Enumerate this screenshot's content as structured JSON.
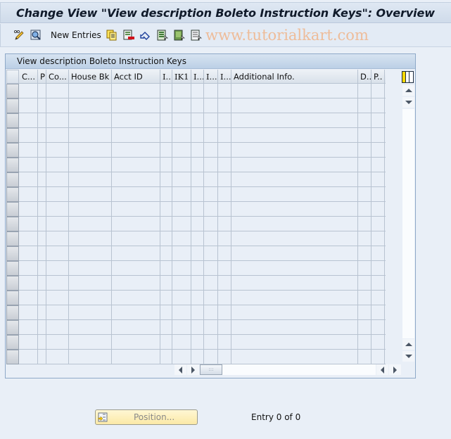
{
  "window": {
    "title": "Change View \"View description Boleto Instruction Keys\": Overview"
  },
  "toolbar": {
    "items": [
      {
        "name": "display-change-icon",
        "label": ""
      },
      {
        "name": "details-icon",
        "label": ""
      },
      {
        "name": "new-entries-button",
        "label": "New Entries"
      },
      {
        "name": "copy-as-icon",
        "label": ""
      },
      {
        "name": "delete-icon",
        "label": ""
      },
      {
        "name": "undo-change-icon",
        "label": ""
      },
      {
        "name": "select-all-icon",
        "label": ""
      },
      {
        "name": "select-block-icon",
        "label": ""
      },
      {
        "name": "deselect-all-icon",
        "label": ""
      }
    ],
    "new_entries_label": "New Entries"
  },
  "watermark": "www.tutorialkart.com",
  "table": {
    "title": "View description Boleto Instruction Keys",
    "columns": [
      {
        "label": "C..."
      },
      {
        "label": "P"
      },
      {
        "label": "Co..."
      },
      {
        "label": "House Bk"
      },
      {
        "label": "Acct ID"
      },
      {
        "label": "I..."
      },
      {
        "label": "IK1"
      },
      {
        "label": "I..."
      },
      {
        "label": "I..."
      },
      {
        "label": "I..."
      },
      {
        "label": "Additional Info."
      },
      {
        "label": "D.."
      },
      {
        "label": "P.."
      }
    ],
    "rows": [],
    "visible_empty_rows": 19
  },
  "footer": {
    "position_button_label": "Position...",
    "entry_status": "Entry 0 of 0"
  },
  "colors": {
    "accent_yellow": "#ffd800",
    "button_bg": "#fbe9a6"
  }
}
